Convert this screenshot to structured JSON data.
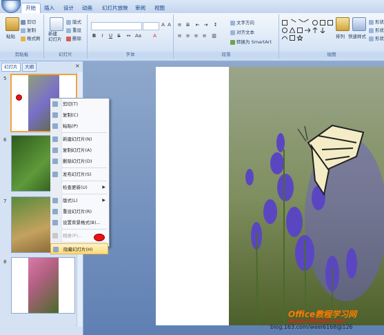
{
  "ribbon_tabs": [
    "开始",
    "插入",
    "设计",
    "动画",
    "幻灯片放映",
    "审阅",
    "视图"
  ],
  "groups": {
    "clipboard": {
      "label": "剪贴板",
      "paste": "粘贴",
      "cut": "剪切",
      "copy": "复制",
      "format_painter": "格式刷"
    },
    "slides": {
      "label": "幻灯片",
      "new_slide": "新建\n幻灯片",
      "layout": "版式",
      "reset": "重设",
      "delete": "删除"
    },
    "font": {
      "label": "字体"
    },
    "paragraph": {
      "label": "段落",
      "text_direction": "文字方向",
      "align_text": "对齐文本",
      "smartart": "转换为 SmartArt"
    },
    "drawing": {
      "label": "绘图",
      "arrange": "排列",
      "quick_styles": "快速样式",
      "shape_fill": "形状",
      "shape_outline": "形状",
      "shape_effects": "形状"
    }
  },
  "pane_tabs": [
    "幻灯片",
    "大纲"
  ],
  "slide_numbers": [
    "5",
    "6",
    "7",
    "8"
  ],
  "context_menu": [
    {
      "label": "剪切(T)",
      "icon": "cut-icon",
      "enabled": true
    },
    {
      "label": "复制(C)",
      "icon": "copy-icon",
      "enabled": true
    },
    {
      "label": "粘贴(P)",
      "icon": "paste-icon",
      "enabled": true
    },
    {
      "sep": true
    },
    {
      "label": "新建幻灯片(N)",
      "icon": "new-slide-icon",
      "enabled": true
    },
    {
      "label": "复制幻灯片(A)",
      "icon": "duplicate-slide-icon",
      "enabled": true
    },
    {
      "label": "删除幻灯片(D)",
      "icon": "delete-slide-icon",
      "enabled": true
    },
    {
      "sep": true
    },
    {
      "label": "发布幻灯片(S)",
      "icon": "publish-icon",
      "enabled": true
    },
    {
      "sep": true
    },
    {
      "label": "检查更新(U)",
      "icon": "",
      "enabled": true,
      "submenu": true
    },
    {
      "sep": true
    },
    {
      "label": "版式(L)",
      "icon": "layout-icon",
      "enabled": true,
      "submenu": true
    },
    {
      "label": "重设幻灯片(R)",
      "icon": "reset-icon",
      "enabled": true
    },
    {
      "label": "设置背景格式(B)...",
      "icon": "background-icon",
      "enabled": true
    },
    {
      "sep": true
    },
    {
      "label": "相册(P)...",
      "icon": "album-icon",
      "enabled": false
    },
    {
      "sep": true
    },
    {
      "label": "隐藏幻灯片(H)",
      "icon": "hide-slide-icon",
      "enabled": true,
      "highlighted": true
    }
  ],
  "watermark": "blog.163.com/weel6168@126",
  "logo_text": "Office教程学习网",
  "logo_url": "www.office68.com"
}
